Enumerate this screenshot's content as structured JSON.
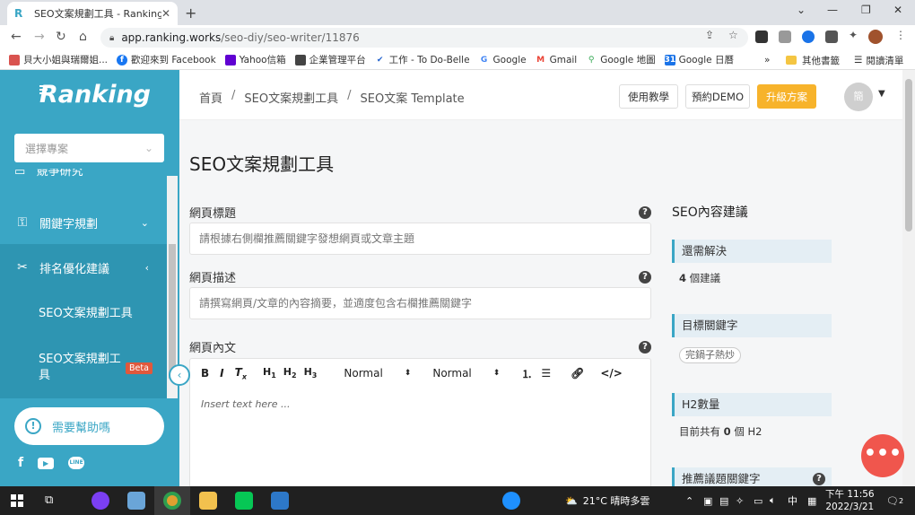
{
  "browser": {
    "tab_title": "SEO文案規劃工具 - Ranking",
    "url_host": "app.ranking.works",
    "url_path": "/seo-diy/seo-writer/11876",
    "bookmarks": [
      {
        "label": "貝大小姐與瑞爾姐...",
        "color": "#d9534f"
      },
      {
        "label": "歡迎來到 Facebook",
        "color": "#1877f2"
      },
      {
        "label": "Yahoo信箱",
        "color": "#6001d2"
      },
      {
        "label": "企業管理平台",
        "color": "#444444"
      },
      {
        "label": "工作 - To Do-Belle",
        "color": "#2564cf"
      },
      {
        "label": "Google",
        "color": "#4285f4"
      },
      {
        "label": "Gmail",
        "color": "#ea4335"
      },
      {
        "label": "Google 地圖",
        "color": "#34a853"
      },
      {
        "label": "Google 日曆",
        "color": "#1a73e8"
      }
    ],
    "bookmark_more": "»",
    "other_bookmarks": "其他書籤",
    "reading_list": "閱讀清單"
  },
  "sidebar": {
    "logo": "Ranking",
    "project_placeholder": "選擇專案",
    "menu": [
      {
        "label": "關鍵字規劃",
        "icon": "keyword-icon",
        "arrow": "⌄"
      },
      {
        "label": "排名優化建議",
        "icon": "tools-icon",
        "arrow": "‹"
      }
    ],
    "sub_items": [
      {
        "label": "SEO文案規劃工具"
      },
      {
        "label": "SEO文案規劃工具",
        "badge": "Beta"
      }
    ],
    "help_label": "需要幫助嗎"
  },
  "topbar": {
    "breadcrumb": [
      "首頁",
      "SEO文案規劃工具",
      "SEO文案 Template"
    ],
    "tutorial_btn": "使用教學",
    "demo_btn": "預約DEMO",
    "upgrade_btn": "升級方案",
    "avatar_text": "簡"
  },
  "main": {
    "page_title": "SEO文案規劃工具",
    "title_label": "網頁標題",
    "title_placeholder": "請根據右側欄推薦關鍵字發想網頁或文章主題",
    "desc_label": "網頁描述",
    "desc_placeholder": "請撰寫網頁/文章的內容摘要，並適度包含右欄推薦關鍵字",
    "content_label": "網頁內文",
    "editor": {
      "normal1": "Normal",
      "normal2": "Normal",
      "placeholder": "Insert text here ..."
    }
  },
  "panel": {
    "title": "SEO內容建議",
    "todo_head": "還需解決",
    "todo_count": "4",
    "todo_unit": "個建議",
    "target_head": "目標關鍵字",
    "target_tag": "完鍋子熱炒",
    "h2_head": "H2數量",
    "h2_prefix": "目前共有",
    "h2_count": "0",
    "h2_suffix": "個 H2",
    "recommend_head": "推薦議題關鍵字"
  },
  "taskbar": {
    "weather": "21°C 晴時多雲",
    "ime": "中",
    "time": "下午 11:56",
    "date": "2022/3/21",
    "notif_count": "2"
  }
}
